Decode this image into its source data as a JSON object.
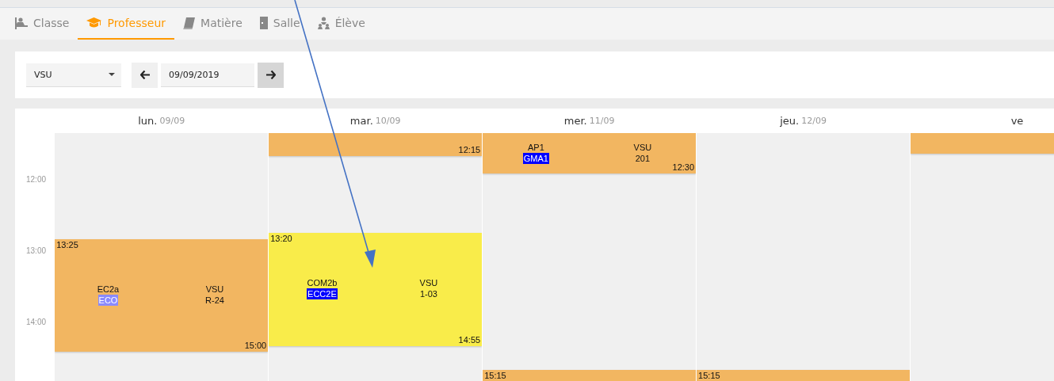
{
  "tabs": [
    {
      "label": "Classe",
      "kind": "desk",
      "selected": false
    },
    {
      "label": "Professeur",
      "kind": "cap",
      "selected": true
    },
    {
      "label": "Matière",
      "kind": "book",
      "selected": false
    },
    {
      "label": "Salle",
      "kind": "door",
      "selected": false
    },
    {
      "label": "Élève",
      "kind": "people",
      "selected": false
    }
  ],
  "toolbar": {
    "teacher_select": {
      "value": "VSU"
    },
    "date_field": {
      "value": "09/09/2019"
    }
  },
  "calendar": {
    "hours": [
      "12:00",
      "13:00",
      "14:00"
    ],
    "days": [
      {
        "name": "lun.",
        "date": "09/09",
        "events": [
          {
            "color": "#f2b661",
            "start": "13:25",
            "end": "15:00",
            "group": "EC2a",
            "subgroup": {
              "text": "ECO",
              "color": "#8a8aff"
            },
            "teacher": "VSU",
            "room": "R-24"
          }
        ]
      },
      {
        "name": "mar.",
        "date": "10/09",
        "events": [
          {
            "color": "#f2b661",
            "end": "12:15"
          },
          {
            "color": "#f9ec4a",
            "start": "13:20",
            "end": "14:55",
            "group": "COM2b",
            "subgroup": {
              "text": "ECC2E",
              "color": "#0000ff"
            },
            "teacher": "VSU",
            "room": "1-03"
          }
        ]
      },
      {
        "name": "mer.",
        "date": "11/09",
        "events": [
          {
            "color": "#f2b661",
            "end": "12:30",
            "group": "AP1",
            "subgroup": {
              "text": "GMA1",
              "color": "#0000ff"
            },
            "teacher": "VSU",
            "room": "201"
          },
          {
            "color": "#f2b661",
            "start": "15:15"
          }
        ]
      },
      {
        "name": "jeu.",
        "date": "12/09",
        "events": [
          {
            "color": "#f2b661",
            "start": "15:15"
          }
        ]
      },
      {
        "name": "ve",
        "events": [
          {
            "color": "#f2b661"
          }
        ]
      }
    ]
  }
}
